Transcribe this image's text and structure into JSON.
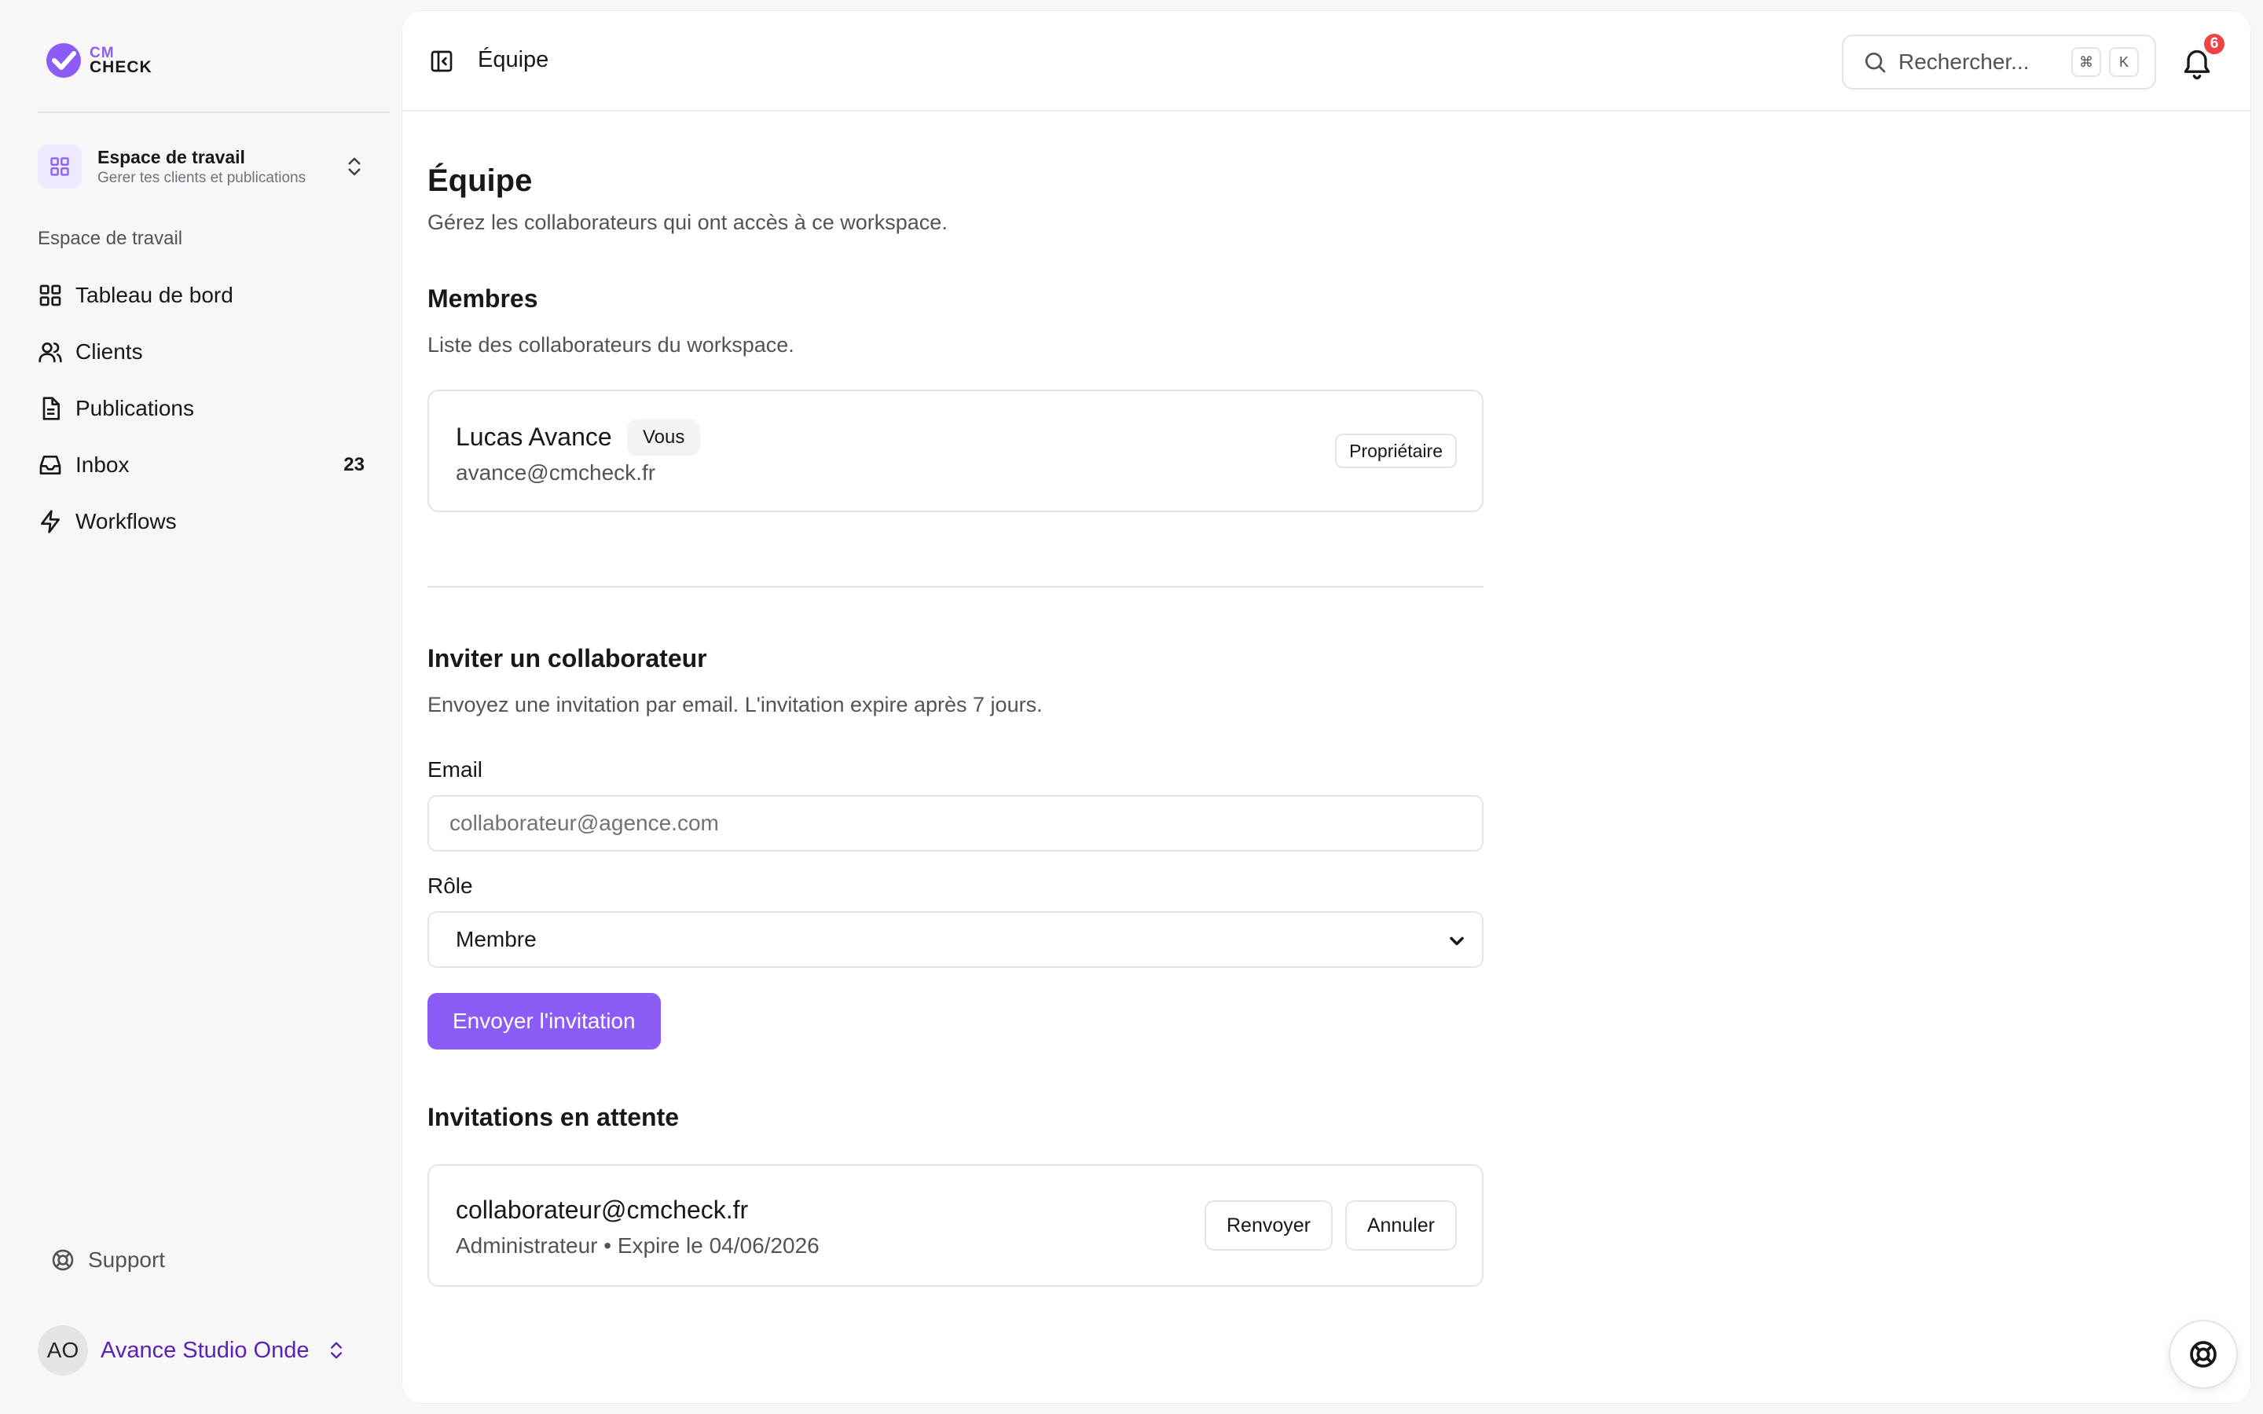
{
  "brand": {
    "line1": "CM",
    "line2": "CHECK",
    "accent": "#8b5cf6"
  },
  "workspace": {
    "title": "Espace de travail",
    "subtitle": "Gerer tes clients et publications"
  },
  "sidebar": {
    "section_label": "Espace de travail",
    "items": [
      {
        "label": "Tableau de bord",
        "icon": "grid-icon"
      },
      {
        "label": "Clients",
        "icon": "users-icon"
      },
      {
        "label": "Publications",
        "icon": "document-icon"
      },
      {
        "label": "Inbox",
        "icon": "inbox-icon",
        "count": "23"
      },
      {
        "label": "Workflows",
        "icon": "lightning-icon"
      }
    ],
    "support_label": "Support",
    "account": {
      "initials": "AO",
      "name": "Avance Studio Onde"
    }
  },
  "topbar": {
    "breadcrumb": "Équipe",
    "search_placeholder": "Rechercher...",
    "shortcut_mod": "⌘",
    "shortcut_key": "K",
    "notifications_count": "6"
  },
  "page": {
    "title": "Équipe",
    "description": "Gérez les collaborateurs qui ont accès à ce workspace."
  },
  "members": {
    "title": "Membres",
    "description": "Liste des collaborateurs du workspace.",
    "list": [
      {
        "name": "Lucas Avance",
        "badge": "Vous",
        "email": "avance@cmcheck.fr",
        "role": "Propriétaire"
      }
    ]
  },
  "invite": {
    "title": "Inviter un collaborateur",
    "description": "Envoyez une invitation par email. L'invitation expire après 7 jours.",
    "email_label": "Email",
    "email_value": "",
    "email_placeholder": "collaborateur@agence.com",
    "role_label": "Rôle",
    "role_value": "Membre",
    "submit_label": "Envoyer l'invitation"
  },
  "pending": {
    "title": "Invitations en attente",
    "list": [
      {
        "email": "collaborateur@cmcheck.fr",
        "meta": "Administrateur • Expire le 04/06/2026",
        "resend_label": "Renvoyer",
        "cancel_label": "Annuler"
      }
    ]
  }
}
